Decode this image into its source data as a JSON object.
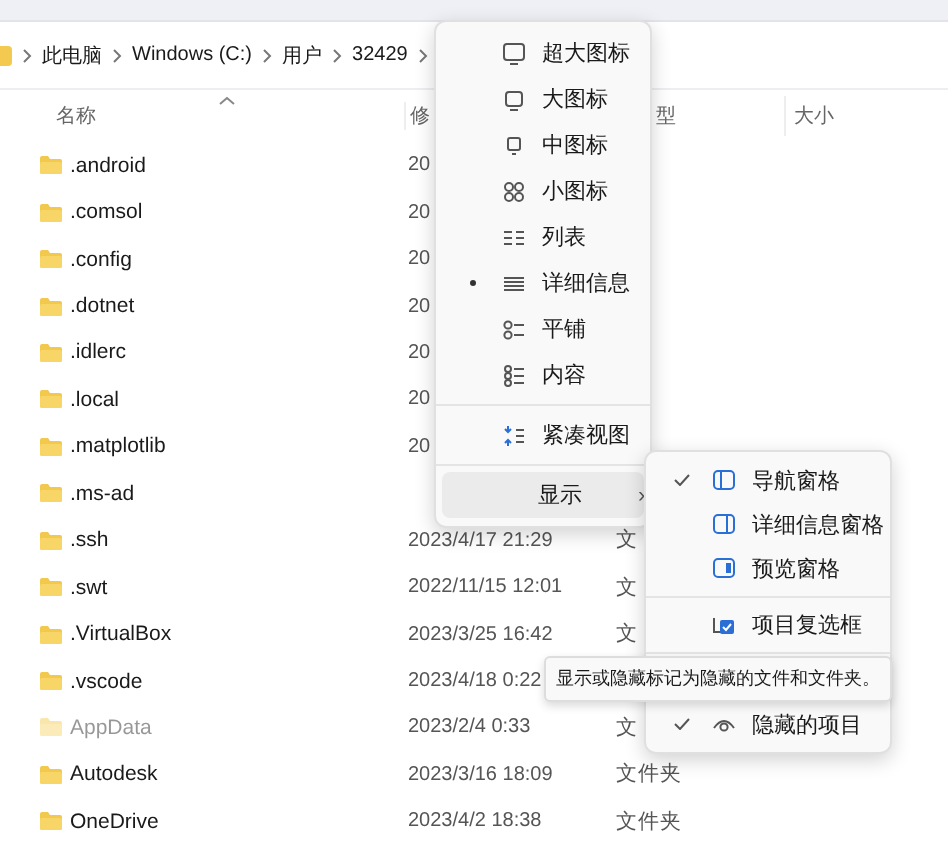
{
  "breadcrumb": [
    "此电脑",
    "Windows (C:)",
    "用户",
    "32429"
  ],
  "columns": [
    "名称",
    "修",
    "型",
    "大小"
  ],
  "rows": [
    {
      "name": ".android",
      "date": "20",
      "hidden": false
    },
    {
      "name": ".comsol",
      "date": "20",
      "hidden": false
    },
    {
      "name": ".config",
      "date": "20",
      "hidden": false
    },
    {
      "name": ".dotnet",
      "date": "20",
      "hidden": false
    },
    {
      "name": ".idlerc",
      "date": "20",
      "hidden": false
    },
    {
      "name": ".local",
      "date": "20",
      "hidden": false
    },
    {
      "name": ".matplotlib",
      "date": "20",
      "hidden": false
    },
    {
      "name": ".ms-ad",
      "hidden": false
    },
    {
      "name": ".ssh",
      "date": "2023/4/17 21:29",
      "type": "文",
      "hidden": false
    },
    {
      "name": ".swt",
      "date": "2022/11/15 12:01",
      "type": "文",
      "hidden": false
    },
    {
      "name": ".VirtualBox",
      "date": "2023/3/25 16:42",
      "type": "文",
      "hidden": false
    },
    {
      "name": ".vscode",
      "date": "2023/4/18 0:22",
      "hidden": false
    },
    {
      "name": "AppData",
      "date": "2023/2/4 0:33",
      "type": "文",
      "hidden": true
    },
    {
      "name": "Autodesk",
      "date": "2023/3/16 18:09",
      "type": "文件夹",
      "hidden": false
    },
    {
      "name": "OneDrive",
      "date": "2023/4/2 18:38",
      "type": "文件夹",
      "hidden": false
    }
  ],
  "view_menu": {
    "items": [
      {
        "label": "超大图标",
        "selected": false
      },
      {
        "label": "大图标",
        "selected": false
      },
      {
        "label": "中图标",
        "selected": false
      },
      {
        "label": "小图标",
        "selected": false
      },
      {
        "label": "列表",
        "selected": false
      },
      {
        "label": "详细信息",
        "selected": true
      },
      {
        "label": "平铺",
        "selected": false
      },
      {
        "label": "内容",
        "selected": false
      }
    ],
    "compact": {
      "label": "紧凑视图"
    },
    "show": {
      "label": "显示",
      "expanded": true,
      "arrow": "›"
    }
  },
  "show_menu": {
    "items": [
      {
        "label": "导航窗格",
        "checked": true
      },
      {
        "label": "详细信息窗格",
        "checked": false
      },
      {
        "label": "预览窗格",
        "checked": false
      },
      {
        "label": "项目复选框",
        "checked": false
      },
      {
        "label": "隐藏的项目",
        "checked": true
      }
    ]
  },
  "tooltip": "显示或隐藏标记为隐藏的文件和文件夹。"
}
